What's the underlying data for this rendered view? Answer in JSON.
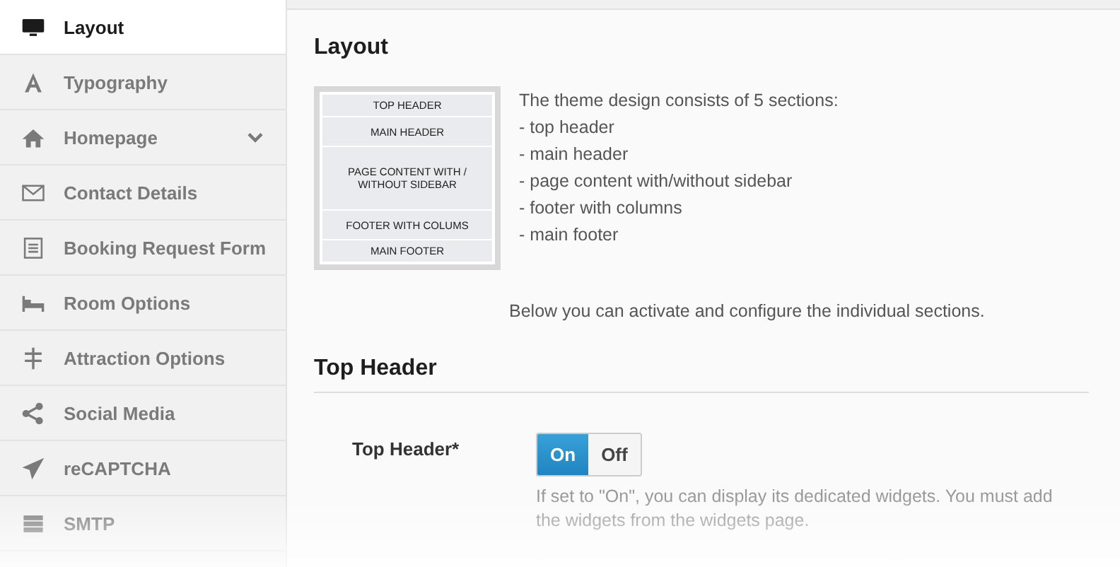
{
  "sidebar": {
    "items": [
      {
        "label": "Layout",
        "kind": "monitor",
        "selected": true,
        "expandable": false
      },
      {
        "label": "Typography",
        "kind": "letter",
        "selected": false,
        "expandable": false
      },
      {
        "label": "Homepage",
        "kind": "home",
        "selected": false,
        "expandable": true
      },
      {
        "label": "Contact Details",
        "kind": "envelope",
        "selected": false,
        "expandable": false
      },
      {
        "label": "Booking Request Form",
        "kind": "form",
        "selected": false,
        "expandable": false
      },
      {
        "label": "Room Options",
        "kind": "bed",
        "selected": false,
        "expandable": false
      },
      {
        "label": "Attraction Options",
        "kind": "signpost",
        "selected": false,
        "expandable": false
      },
      {
        "label": "Social Media",
        "kind": "share",
        "selected": false,
        "expandable": false
      },
      {
        "label": "reCAPTCHA",
        "kind": "plane",
        "selected": false,
        "expandable": false
      },
      {
        "label": "SMTP",
        "kind": "server",
        "selected": false,
        "expandable": false
      }
    ]
  },
  "layout_section": {
    "title": "Layout",
    "diagram": [
      "TOP HEADER",
      "MAIN HEADER",
      "PAGE CONTENT WITH / WITHOUT SIDEBAR",
      "FOOTER WITH COLUMS",
      "MAIN FOOTER"
    ],
    "intro": "The theme design consists of 5 sections:",
    "list": [
      "- top header",
      "- main header",
      "- page content with/without sidebar",
      "- footer with columns",
      "- main footer"
    ],
    "note": "Below you can activate and configure the individual sections."
  },
  "top_header_section": {
    "title": "Top Header",
    "setting": {
      "label": "Top Header*",
      "options": [
        {
          "label": "On",
          "selected": true
        },
        {
          "label": "Off",
          "selected": false
        }
      ],
      "help": "If set to \"On\", you can display its dedicated widgets. You must add the widgets from the widgets page."
    }
  }
}
